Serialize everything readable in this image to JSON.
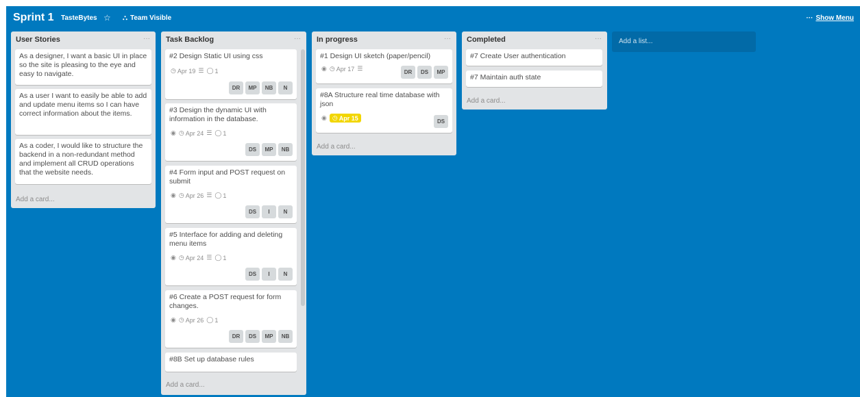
{
  "board": {
    "title": "Sprint 1",
    "team": "TasteBytes",
    "visibility": "Team Visible",
    "show_menu": "Show Menu",
    "add_list": "Add a list..."
  },
  "lists": [
    {
      "title": "User Stories",
      "add_card": "Add a card...",
      "cards": [
        {
          "title": "As a designer, I want a basic UI in place so the site is pleasing to the eye and easy to navigate."
        },
        {
          "title": "As a user I want to easily be able to add and update menu items so I can have correct information about the items."
        },
        {
          "title": "As a coder, I would like to structure the backend in a non-redundant method and implement all CRUD operations that the website needs."
        }
      ]
    },
    {
      "title": "Task Backlog",
      "add_card": "Add a card...",
      "cards": [
        {
          "title": "#2 Design Static UI using css",
          "due": "Apr 19",
          "comments": "1",
          "members": [
            "DR",
            "MP",
            "NB",
            "N"
          ]
        },
        {
          "title": "#3 Design the dynamic UI with information in the database.",
          "due": "Apr 24",
          "comments": "1",
          "members": [
            "DS",
            "MP",
            "NB"
          ]
        },
        {
          "title": "#4 Form input and POST request on submit",
          "due": "Apr 26",
          "comments": "1",
          "members": [
            "DS",
            "I",
            "N"
          ]
        },
        {
          "title": "#5 Interface for adding and deleting menu items",
          "due": "Apr 24",
          "comments": "1",
          "members": [
            "DS",
            "I",
            "N"
          ]
        },
        {
          "title": "#6 Create a POST request for form changes.",
          "due": "Apr 26",
          "comments": "1",
          "members": [
            "DR",
            "DS",
            "MP",
            "NB"
          ]
        },
        {
          "title": "#8B Set up database rules"
        }
      ]
    },
    {
      "title": "In progress",
      "add_card": "Add a card...",
      "cards": [
        {
          "title": "#1 Design UI sketch (paper/pencil)",
          "due": "Apr 17",
          "members": [
            "DR",
            "DS",
            "MP"
          ]
        },
        {
          "title": "#8A Structure real time database with json",
          "due": "Apr 15",
          "members": [
            "DS"
          ]
        }
      ]
    },
    {
      "title": "Completed",
      "add_card": "Add a card...",
      "cards": [
        {
          "title": "#7 Create User authentication"
        },
        {
          "title": "#7 Maintain auth state"
        }
      ]
    }
  ],
  "icons": {
    "list_menu": "···",
    "star": "☆",
    "visibility": "⛬",
    "watch": "◉",
    "clock": "◷",
    "description": "☰",
    "comment": "◯"
  },
  "colors": {
    "board_bg": "#0079bf",
    "due_soon": "#f2d600"
  }
}
